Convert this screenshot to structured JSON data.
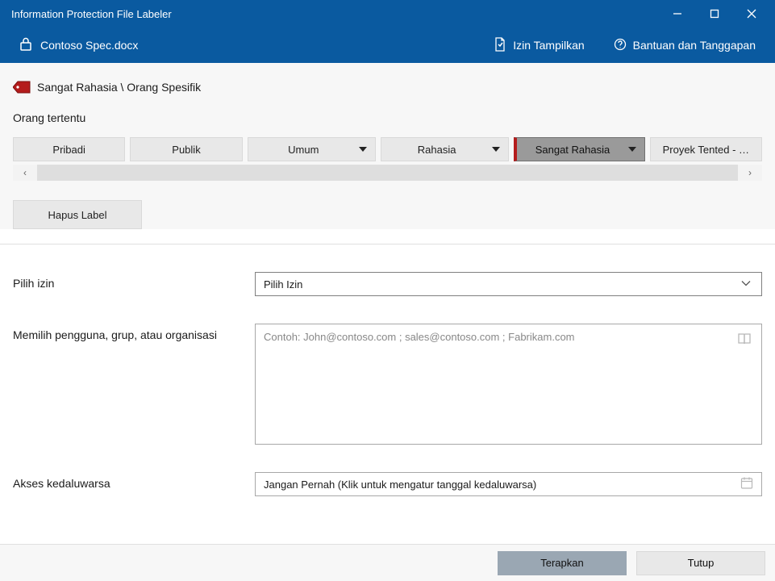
{
  "titlebar": {
    "title": "Information Protection File Labeler"
  },
  "header": {
    "filename": "Contoso Spec.docx",
    "show_perms": "Izin Tampilkan",
    "help": "Bantuan dan Tanggapan"
  },
  "label_path": "Sangat Rahasia \\ Orang Spesifik",
  "specific_people": "Orang tertentu",
  "tabs": [
    {
      "label": "Pribadi",
      "dropdown": false,
      "selected": false
    },
    {
      "label": "Publik",
      "dropdown": false,
      "selected": false
    },
    {
      "label": "Umum",
      "dropdown": true,
      "selected": false
    },
    {
      "label": "Rahasia",
      "dropdown": true,
      "selected": false
    },
    {
      "label": "Sangat Rahasia",
      "dropdown": true,
      "selected": true
    },
    {
      "label": "Proyek Tented - …",
      "dropdown": false,
      "selected": false
    }
  ],
  "delete_label": "Hapus Label",
  "form": {
    "perm_label": "Pilih izin",
    "perm_value": "Pilih Izin",
    "users_label": "Memilih pengguna, grup, atau organisasi",
    "users_placeholder": "Contoh: John@contoso.com ; sales@contoso.com ; Fabrikam.com",
    "expiry_label": "Akses kedaluwarsa",
    "expiry_value": "Jangan Pernah (Klik untuk mengatur tanggal kedaluwarsa)"
  },
  "footer": {
    "apply": "Terapkan",
    "close": "Tutup"
  }
}
